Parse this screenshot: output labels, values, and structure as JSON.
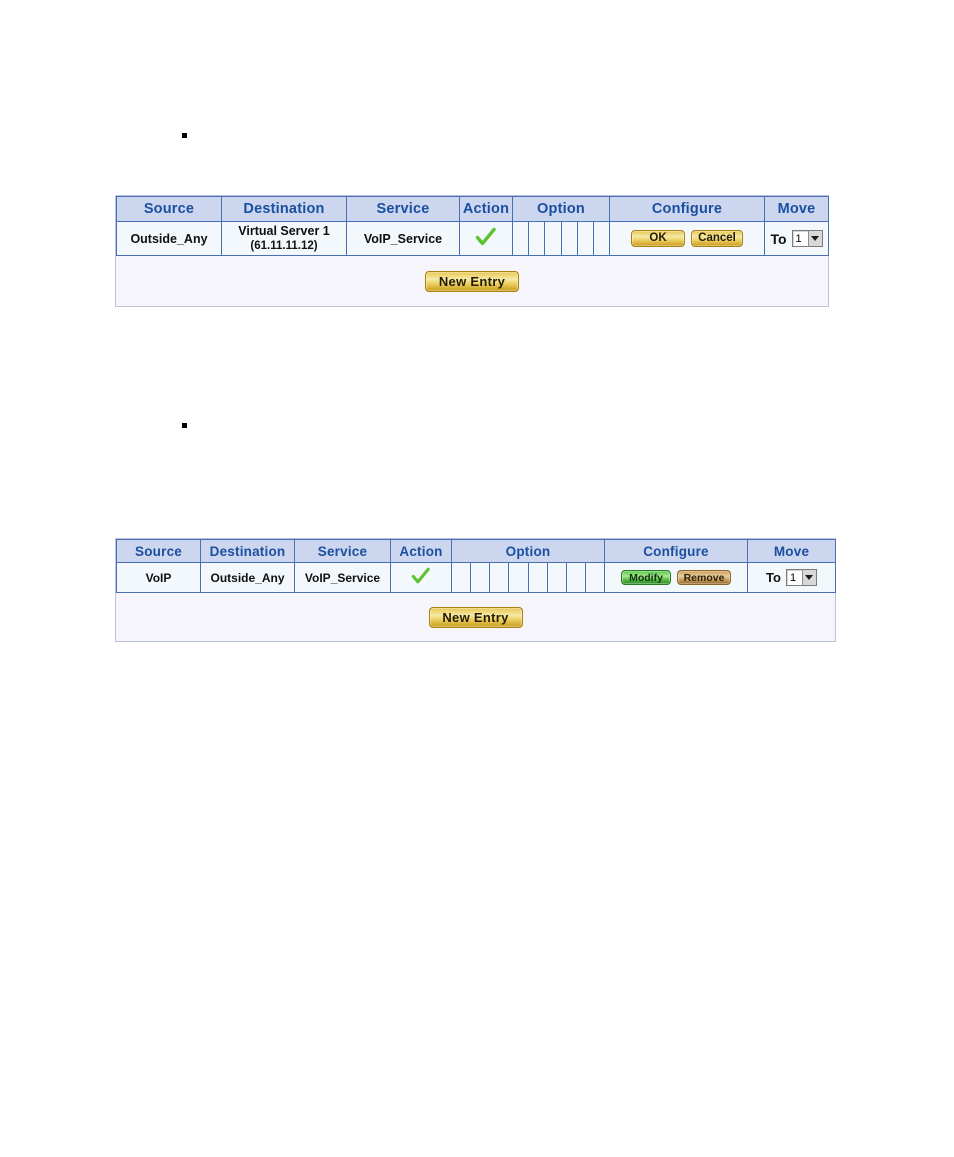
{
  "document": {
    "bullets": [
      "square-bullet",
      "square-bullet"
    ]
  },
  "tables": [
    {
      "id": "virtual-server-policy",
      "columns": [
        "Source",
        "Destination",
        "Service",
        "Action",
        "Option",
        "Configure",
        "Move"
      ],
      "option_cell_count": 6,
      "row": {
        "source": "Outside_Any",
        "destination_line1": "Virtual Server 1",
        "destination_line2": "(61.11.11.12)",
        "service": "VoIP_Service",
        "action_icon": "green-check-icon",
        "configure_buttons": [
          {
            "label": "OK",
            "style": "gold"
          },
          {
            "label": "Cancel",
            "style": "gold"
          }
        ],
        "move_label": "To",
        "move_value": "1",
        "move_options": [
          "1"
        ]
      },
      "footer": {
        "new_entry_label": "New Entry"
      }
    },
    {
      "id": "voip-outbound-policy",
      "columns": [
        "Source",
        "Destination",
        "Service",
        "Action",
        "Option",
        "Configure",
        "Move"
      ],
      "option_cell_count": 8,
      "row": {
        "source": "VoIP",
        "destination_line1": "Outside_Any",
        "destination_line2": "",
        "service": "VoIP_Service",
        "action_icon": "green-check-icon",
        "configure_buttons": [
          {
            "label": "Modify",
            "style": "green"
          },
          {
            "label": "Remove",
            "style": "tan"
          }
        ],
        "move_label": "To",
        "move_value": "1",
        "move_options": [
          "1"
        ]
      },
      "footer": {
        "new_entry_label": "New Entry"
      }
    }
  ],
  "colors": {
    "header_bg": "#ccd6ef",
    "header_text": "#1b4fa0",
    "grid_line": "#4a6fb5",
    "cell_bg": "#f3f8fd",
    "footer_bg": "#f6f5fb",
    "check_green": "#5cc32f",
    "gold_button": "#eccf5f",
    "green_button": "#57c34a",
    "tan_button": "#c49a55"
  }
}
